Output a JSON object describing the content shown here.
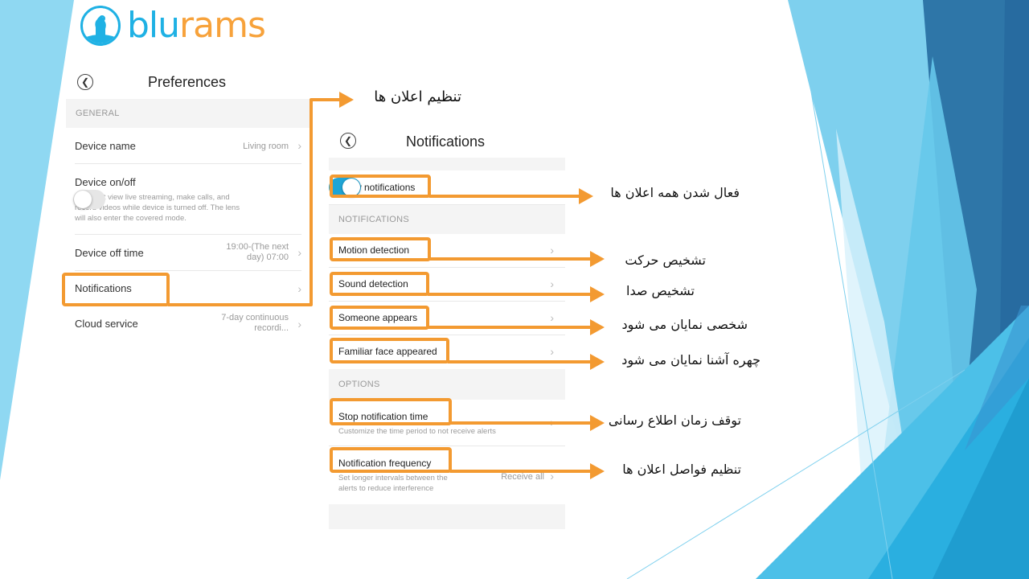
{
  "brand": {
    "name_part1": "blu",
    "name_part2": "rams",
    "primary_color": "#1fb1e4",
    "accent_color": "#f7a23b"
  },
  "annotation_color": "#f39a31",
  "preferences": {
    "title": "Preferences",
    "back_icon": "chevron-left-circle-icon",
    "section_general": "GENERAL",
    "rows": {
      "device_name": {
        "label": "Device name",
        "value": "Living room"
      },
      "device_onoff": {
        "label": "Device on/off",
        "description": "You can't view live streaming, make calls, and record videos while device is turned off. The lens will also enter the covered mode.",
        "toggle_on": false
      },
      "device_off_time": {
        "label": "Device off time",
        "value_line1": "19:00-(The next",
        "value_line2": "day) 07:00"
      },
      "notifications": {
        "label": "Notifications"
      },
      "cloud_service": {
        "label": "Cloud service",
        "value_line1": "7-day continuous",
        "value_line2": "recordi..."
      }
    }
  },
  "notifications": {
    "title": "Notifications",
    "back_icon": "chevron-left-circle-icon",
    "allow": {
      "label": "Allow notifications",
      "toggle_on": true
    },
    "section_notifications": "NOTIFICATIONS",
    "items": [
      {
        "label": "Motion detection"
      },
      {
        "label": "Sound detection"
      },
      {
        "label": "Someone appears"
      },
      {
        "label": "Familiar face appeared"
      }
    ],
    "section_options": "OPTIONS",
    "stop_time": {
      "label": "Stop notification time",
      "description": "Customize the time period to not receive alerts"
    },
    "frequency": {
      "label": "Notification frequency",
      "description_line1": "Set longer intervals between the",
      "description_line2": "alerts to reduce interference",
      "value": "Receive all"
    }
  },
  "annotations": {
    "notification_settings": "تنظیم اعلان ها",
    "allow_all": "فعال شدن همه اعلان ها",
    "motion": "تشخیص حرکت",
    "sound": "تشخیص صدا",
    "someone": "شخصی نمایان می شود",
    "familiar_face": "چهره آشنا نمایان می شود",
    "stop_time": "توقف زمان اطلاع رسانی",
    "frequency": "تنظیم فواصل اعلان ها"
  }
}
